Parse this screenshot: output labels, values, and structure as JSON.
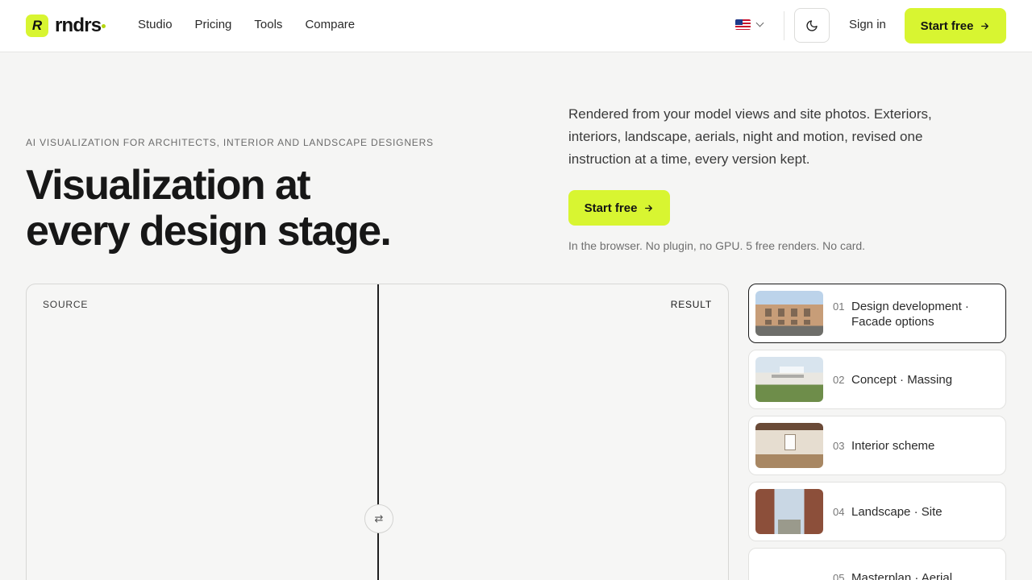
{
  "header": {
    "logo_mark": "R",
    "logo_text": "rndrs",
    "nav": [
      "Studio",
      "Pricing",
      "Tools",
      "Compare"
    ],
    "language_icon": "us-flag-icon",
    "theme_icon": "moon-icon",
    "sign_in": "Sign in",
    "cta": "Start free"
  },
  "hero": {
    "eyebrow": "AI VISUALIZATION FOR ARCHITECTS, INTERIOR AND LANDSCAPE DESIGNERS",
    "headline_line1": "Visualization at",
    "headline_line2": "every design stage.",
    "description": "Rendered from your model views and site photos. Exteriors, interiors, landscape, aerials, night and motion, revised one instruction at a time, every version kept.",
    "cta": "Start free",
    "note": "In the browser. No plugin, no GPU. 5 free renders. No card."
  },
  "compare": {
    "source_label": "SOURCE",
    "result_label": "RESULT",
    "handle_glyph": "⇄"
  },
  "stages": [
    {
      "num": "01",
      "title": "Design development · Facade options",
      "active": true
    },
    {
      "num": "02",
      "title": "Concept · Massing",
      "active": false
    },
    {
      "num": "03",
      "title": "Interior scheme",
      "active": false
    },
    {
      "num": "04",
      "title": "Landscape · Site",
      "active": false
    },
    {
      "num": "05",
      "title": "Masterplan · Aerial",
      "active": false
    }
  ],
  "colors": {
    "accent": "#d8f531",
    "background": "#f5f5f4",
    "text": "#171717"
  }
}
